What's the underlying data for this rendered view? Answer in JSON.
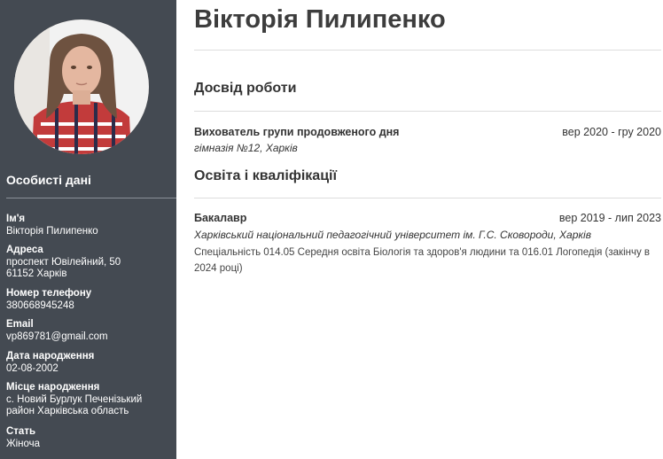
{
  "sidebar": {
    "photo": "profile-photo",
    "personal_heading": "Особисті дані",
    "fields": {
      "name_label": "Ім'я",
      "name_value": "Вікторія Пилипенко",
      "address_label": "Адреса",
      "address_line1": "проспект Ювілейний, 50",
      "address_line2": "61152 Харків",
      "phone_label": "Номер телефону",
      "phone_value": "380668945248",
      "email_label": "Email",
      "email_value": "vp869781@gmail.com",
      "birthdate_label": "Дата народження",
      "birthdate_value": "02-08-2002",
      "birthplace_label": "Місце народження",
      "birthplace_value": "с. Новий Бурлук Печенізький район Харківська область",
      "gender_label": "Стать",
      "gender_value": "Жіноча"
    }
  },
  "main": {
    "name": "Вікторія Пилипенко",
    "experience": {
      "title": "Досвід роботи",
      "items": [
        {
          "position": "Вихователь групи продовженого дня",
          "dates": "вер 2020 - гру 2020",
          "org": "гімназія №12, Харків"
        }
      ]
    },
    "education": {
      "title": "Освіта і кваліфікації",
      "items": [
        {
          "degree": "Бакалавр",
          "dates": "вер 2019 - лип 2023",
          "org": "Харківський національний педагогічний університет ім. Г.С. Сковороди, Харків",
          "description": "Спеціальність 014.05 Середня освіта Біологія та здоров'я людини та 016.01 Логопедія (закінчу в 2024 році)"
        }
      ]
    }
  }
}
